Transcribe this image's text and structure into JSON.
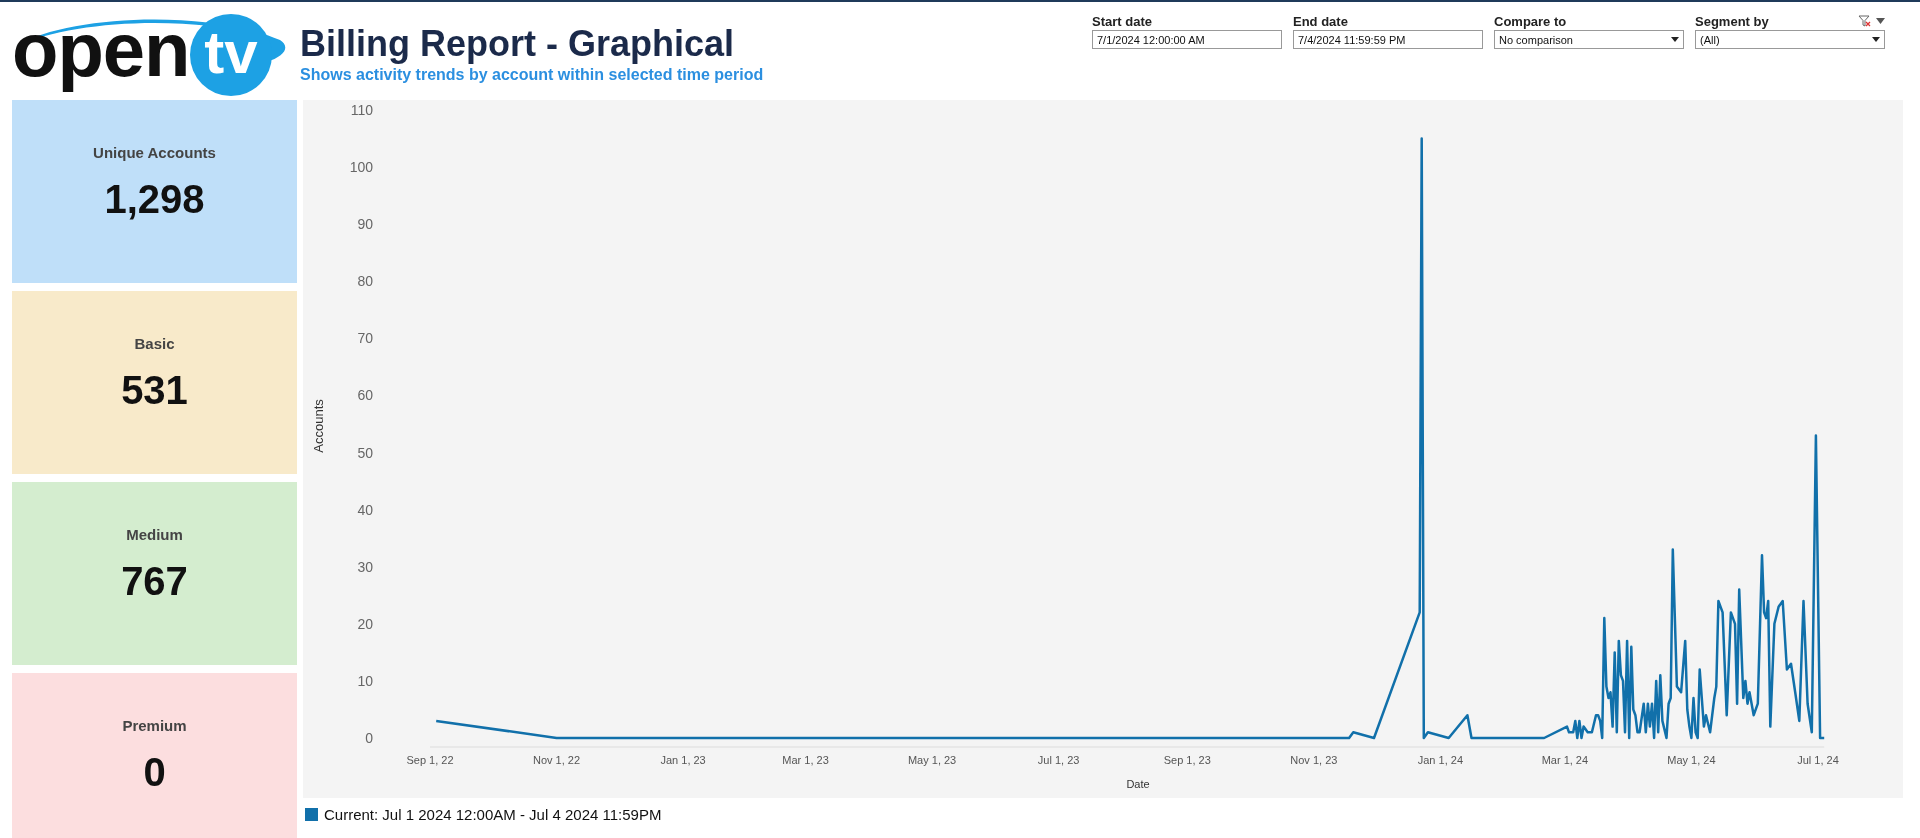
{
  "logo": {
    "text": "open",
    "badge": "tv"
  },
  "header": {
    "title": "Billing Report - Graphical",
    "subtitle": "Shows activity trends by account within selected time period"
  },
  "filters": [
    {
      "label": "Start date",
      "kind": "text",
      "value": "7/1/2024 12:00:00 AM"
    },
    {
      "label": "End date",
      "kind": "text",
      "value": "7/4/2024 11:59:59 PM"
    },
    {
      "label": "Compare to",
      "kind": "dropdown",
      "value": "No comparison"
    },
    {
      "label": "Segment by",
      "kind": "dropdown",
      "value": "(All)",
      "filter_menu": true
    }
  ],
  "cards": [
    {
      "label": "Unique Accounts",
      "value": "1,298",
      "color": "#bfdff9"
    },
    {
      "label": "Basic",
      "value": "531",
      "color": "#f8eaca"
    },
    {
      "label": "Medium",
      "value": "767",
      "color": "#d4edcf"
    },
    {
      "label": "Premium",
      "value": "0",
      "color": "#fcdedf"
    }
  ],
  "chart": {
    "chart_data": {
      "type": "line",
      "xlabel": "Date",
      "ylabel": "Accounts",
      "x": [
        "2022-09-04",
        "2022-11-01",
        "2023-11-18",
        "2023-11-20",
        "2023-11-30",
        "2023-12-22",
        "2023-12-23",
        "2023-12-24",
        "2023-12-26",
        "2024-01-05",
        "2024-01-14",
        "2024-01-16",
        "2024-02-20",
        "2024-03-02",
        "2024-03-03",
        "2024-03-05",
        "2024-03-06",
        "2024-03-07",
        "2024-03-08",
        "2024-03-09",
        "2024-03-10",
        "2024-03-12",
        "2024-03-14",
        "2024-03-16",
        "2024-03-17",
        "2024-03-18",
        "2024-03-19",
        "2024-03-20",
        "2024-03-21",
        "2024-03-22",
        "2024-03-23",
        "2024-03-24",
        "2024-03-25",
        "2024-03-26",
        "2024-03-27",
        "2024-03-28",
        "2024-03-29",
        "2024-03-30",
        "2024-03-31",
        "2024-04-01",
        "2024-04-02",
        "2024-04-03",
        "2024-04-04",
        "2024-04-05",
        "2024-04-06",
        "2024-04-08",
        "2024-04-09",
        "2024-04-10",
        "2024-04-11",
        "2024-04-12",
        "2024-04-13",
        "2024-04-14",
        "2024-04-15",
        "2024-04-16",
        "2024-04-17",
        "2024-04-19",
        "2024-04-20",
        "2024-04-21",
        "2024-04-22",
        "2024-04-24",
        "2024-04-26",
        "2024-04-28",
        "2024-04-29",
        "2024-04-30",
        "2024-05-01",
        "2024-05-02",
        "2024-05-03",
        "2024-05-04",
        "2024-05-05",
        "2024-05-07",
        "2024-05-08",
        "2024-05-10",
        "2024-05-12",
        "2024-05-13",
        "2024-05-14",
        "2024-05-16",
        "2024-05-18",
        "2024-05-20",
        "2024-05-22",
        "2024-05-23",
        "2024-05-24",
        "2024-05-26",
        "2024-05-27",
        "2024-05-28",
        "2024-05-29",
        "2024-05-31",
        "2024-06-02",
        "2024-06-04",
        "2024-06-05",
        "2024-06-06",
        "2024-06-07",
        "2024-06-08",
        "2024-06-10",
        "2024-06-12",
        "2024-06-14",
        "2024-06-16",
        "2024-06-18",
        "2024-06-20",
        "2024-06-22",
        "2024-06-24",
        "2024-06-26",
        "2024-06-28",
        "2024-06-30",
        "2024-07-02",
        "2024-07-04"
      ],
      "series": [
        {
          "name": "Current: Jul 1 2024 12:00AM - Jul 4 2024 11:59PM",
          "color": "#1170aa",
          "values": [
            3,
            0,
            0,
            1,
            0,
            22,
            105,
            0,
            1,
            0,
            4,
            0,
            0,
            2,
            1,
            1,
            3,
            0,
            3,
            0,
            2,
            1,
            1,
            4,
            4,
            3,
            0,
            21,
            9,
            7,
            8,
            2,
            15,
            1,
            17,
            11,
            10,
            1,
            17,
            0,
            16,
            5,
            4,
            1,
            1,
            6,
            1,
            6,
            2,
            6,
            0,
            10,
            1,
            11,
            3,
            0,
            6,
            7,
            33,
            9,
            8,
            17,
            5,
            2,
            0,
            7,
            1,
            0,
            12,
            2,
            4,
            1,
            7,
            9,
            24,
            22,
            4,
            22,
            20,
            6,
            26,
            7,
            10,
            6,
            8,
            4,
            6,
            32,
            22,
            21,
            24,
            2,
            20,
            23,
            24,
            12,
            13,
            8,
            3,
            24,
            6,
            1,
            53,
            0,
            0
          ]
        }
      ],
      "xlim": [
        "2022-09-01",
        "2024-07-04"
      ],
      "ylim": [
        0,
        110
      ],
      "yticks": [
        0,
        10,
        20,
        30,
        40,
        50,
        60,
        70,
        80,
        90,
        100,
        110
      ],
      "xticks": [
        {
          "value": "2022-09-01",
          "label": "Sep 1, 22"
        },
        {
          "value": "2022-11-01",
          "label": "Nov 1, 22"
        },
        {
          "value": "2023-01-01",
          "label": "Jan 1, 23"
        },
        {
          "value": "2023-03-01",
          "label": "Mar 1, 23"
        },
        {
          "value": "2023-05-01",
          "label": "May 1, 23"
        },
        {
          "value": "2023-07-01",
          "label": "Jul 1, 23"
        },
        {
          "value": "2023-09-01",
          "label": "Sep 1, 23"
        },
        {
          "value": "2023-11-01",
          "label": "Nov 1, 23"
        },
        {
          "value": "2024-01-01",
          "label": "Jan 1, 24"
        },
        {
          "value": "2024-03-01",
          "label": "Mar 1, 24"
        },
        {
          "value": "2024-05-01",
          "label": "May 1, 24"
        },
        {
          "value": "2024-07-01",
          "label": "Jul 1, 24"
        }
      ]
    }
  }
}
